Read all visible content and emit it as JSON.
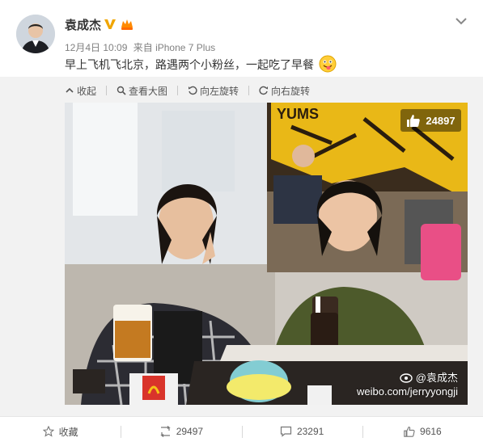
{
  "post": {
    "author": "袁成杰",
    "timestamp": "12月4日 10:09",
    "source": "来自 iPhone 7 Plus",
    "text": "早上飞机飞北京，路遇两个小粉丝，一起吃了早餐"
  },
  "media_toolbar": {
    "collapse": "收起",
    "view_large": "查看大图",
    "rotate_left": "向左旋转",
    "rotate_right": "向右旋转"
  },
  "photo": {
    "like_count": "24897",
    "watermark_name": "@袁成杰",
    "watermark_url": "weibo.com/jerryyongji",
    "sign_text": "YUMS"
  },
  "actions": {
    "favorite": "收藏",
    "repost_count": "29497",
    "comment_count": "23291",
    "like_count": "9616"
  },
  "icons": [
    "verified-v-icon",
    "vip-badge-icon",
    "chevron-down-icon",
    "collapse-icon",
    "magnifier-icon",
    "rotate-left-icon",
    "rotate-right-icon",
    "thumbs-up-icon",
    "weibo-eye-icon",
    "star-icon",
    "repost-icon",
    "comment-icon",
    "like-icon"
  ],
  "colors": {
    "verified": "#f0a500",
    "accent_orange": "#ff8200",
    "text_dark": "#333333",
    "text_meta": "#808080"
  }
}
